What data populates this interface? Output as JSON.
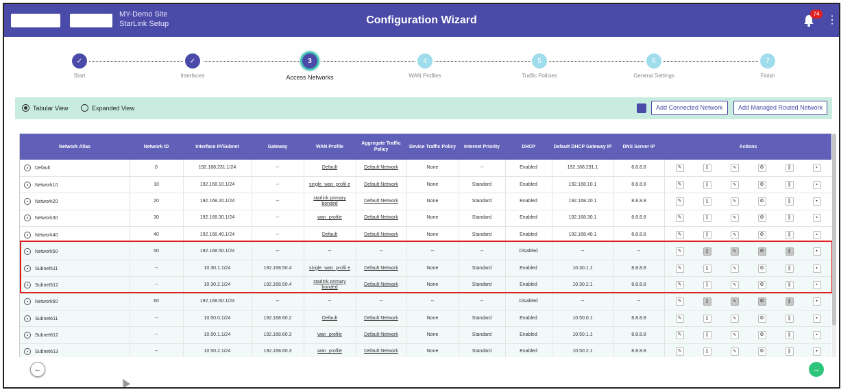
{
  "header": {
    "site_line1": "MY-Demo Site",
    "site_line2": "StarLink Setup",
    "title": "Configuration Wizard",
    "notifications": "74",
    "accent": "#4a4aa8",
    "menu_icon": "kebab-icon"
  },
  "steps": [
    {
      "label": "Start",
      "marker": "✓",
      "state": "done"
    },
    {
      "label": "Interfaces",
      "marker": "✓",
      "state": "done"
    },
    {
      "label": "Access Networks",
      "marker": "3",
      "state": "current"
    },
    {
      "label": "WAN Profiles",
      "marker": "4",
      "state": "todo"
    },
    {
      "label": "Traffic Policies",
      "marker": "5",
      "state": "todo"
    },
    {
      "label": "General Settings",
      "marker": "6",
      "state": "todo"
    },
    {
      "label": "Finish",
      "marker": "7",
      "state": "todo"
    }
  ],
  "view": {
    "tabular": "Tabular View",
    "expanded": "Expanded View",
    "selected": "tabular",
    "add_connected": "Add Connected Network",
    "add_managed": "Add Managed Routed Network"
  },
  "table": {
    "headers": [
      "Network Alias",
      "Network ID",
      "Interface IP/Subnet",
      "Gateway",
      "WAN Profile",
      "Aggregate Traffic Policy",
      "Device Traffic Policy",
      "Internet Priority",
      "DHCP",
      "Default DHCP Gateway IP",
      "DNS Server IP",
      "Actions"
    ],
    "rows": [
      {
        "alias": "Default",
        "id": "0",
        "ip": "192.168.231.1/24",
        "gw": "--",
        "wan": "Default",
        "agg": "Default Network",
        "dev": "None",
        "prio": "--",
        "dhcp": "Enabled",
        "dgw": "192.168.231.1",
        "dns": "8.8.8.8",
        "band": false,
        "disabled_actions": false
      },
      {
        "alias": "Network10",
        "id": "10",
        "ip": "192.168.10.1/24",
        "gw": "--",
        "wan": "single_wan_profil e",
        "agg": "Default Network",
        "dev": "None",
        "prio": "Standard",
        "dhcp": "Enabled",
        "dgw": "192.168.10.1",
        "dns": "8.8.8.8",
        "band": false,
        "disabled_actions": false
      },
      {
        "alias": "Network20",
        "id": "20",
        "ip": "192.168.20.1/24",
        "gw": "--",
        "wan": "starlink primary bonded",
        "agg": "Default Network",
        "dev": "None",
        "prio": "Standard",
        "dhcp": "Enabled",
        "dgw": "192.168.20.1",
        "dns": "8.8.8.8",
        "band": false,
        "disabled_actions": false
      },
      {
        "alias": "Network30",
        "id": "30",
        "ip": "192.168.30.1/24",
        "gw": "--",
        "wan": "wan_profile",
        "agg": "Default Network",
        "dev": "None",
        "prio": "Standard",
        "dhcp": "Enabled",
        "dgw": "192.168.30.1",
        "dns": "8.8.8.8",
        "band": false,
        "disabled_actions": false
      },
      {
        "alias": "Network40",
        "id": "40",
        "ip": "192.168.40.1/24",
        "gw": "--",
        "wan": "Default",
        "agg": "Default Network",
        "dev": "None",
        "prio": "Standard",
        "dhcp": "Enabled",
        "dgw": "192.168.40.1",
        "dns": "8.8.8.8",
        "band": false,
        "disabled_actions": false
      },
      {
        "alias": "Network50",
        "id": "50",
        "ip": "192.168.50.1/24",
        "gw": "--",
        "wan": "--",
        "agg": "--",
        "dev": "--",
        "prio": "--",
        "dhcp": "Disabled",
        "dgw": "--",
        "dns": "--",
        "band": true,
        "disabled_actions": true
      },
      {
        "alias": "Subnet511",
        "id": "--",
        "ip": "10.30.1.1/24",
        "gw": "192.168.50.4",
        "wan": "single_wan_profil e",
        "agg": "Default Network",
        "dev": "None",
        "prio": "Standard",
        "dhcp": "Enabled",
        "dgw": "10.30.1.1",
        "dns": "8.8.8.8",
        "band": true,
        "disabled_actions": false
      },
      {
        "alias": "Subnet512",
        "id": "--",
        "ip": "10.30.2.1/24",
        "gw": "192.168.50.4",
        "wan": "starlink primary bonded",
        "agg": "Default Network",
        "dev": "None",
        "prio": "Standard",
        "dhcp": "Enabled",
        "dgw": "10.30.2.1",
        "dns": "8.8.8.8",
        "band": true,
        "disabled_actions": false
      },
      {
        "alias": "Network60",
        "id": "60",
        "ip": "192.168.60.1/24",
        "gw": "--",
        "wan": "--",
        "agg": "--",
        "dev": "--",
        "prio": "--",
        "dhcp": "Disabled",
        "dgw": "--",
        "dns": "--",
        "band": true,
        "disabled_actions": true
      },
      {
        "alias": "Subnet611",
        "id": "--",
        "ip": "10.50.0.1/24",
        "gw": "192.168.60.2",
        "wan": "Default",
        "agg": "Default Network",
        "dev": "None",
        "prio": "Standard",
        "dhcp": "Enabled",
        "dgw": "10.50.0.1",
        "dns": "8.8.8.8",
        "band": true,
        "disabled_actions": false
      },
      {
        "alias": "Subnet612",
        "id": "--",
        "ip": "10.50.1.1/24",
        "gw": "192.168.60.3",
        "wan": "wan_profile",
        "agg": "Default Network",
        "dev": "None",
        "prio": "Standard",
        "dhcp": "Enabled",
        "dgw": "10.50.1.1",
        "dns": "8.8.8.8",
        "band": true,
        "disabled_actions": false
      },
      {
        "alias": "Subnet613",
        "id": "--",
        "ip": "10.50.2.1/24",
        "gw": "192.168.60.3",
        "wan": "wan_profile",
        "agg": "Default Network",
        "dev": "None",
        "prio": "Standard",
        "dhcp": "Enabled",
        "dgw": "10.50.2.1",
        "dns": "8.8.8.8",
        "band": true,
        "disabled_actions": false
      }
    ],
    "action_icons": [
      {
        "name": "edit-icon",
        "glyph": "✎"
      },
      {
        "name": "copy-icon",
        "glyph": "▯"
      },
      {
        "name": "chart-icon",
        "glyph": "∿"
      },
      {
        "name": "settings-icon",
        "glyph": "⚙"
      },
      {
        "name": "pause-icon",
        "glyph": "∥"
      },
      {
        "name": "delete-icon",
        "glyph": "▪"
      }
    ]
  },
  "nav": {
    "back": "←",
    "next": "→"
  }
}
